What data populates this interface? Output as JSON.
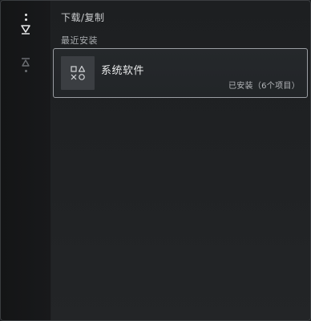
{
  "colors": {
    "background": "#1e2022",
    "rail": "#151617",
    "card_border": "#9a9ea3",
    "thumb": "#3b3e42"
  },
  "rail": {
    "items": [
      {
        "icon": "download-icon",
        "active": true
      },
      {
        "icon": "upload-icon",
        "active": false
      }
    ]
  },
  "header": {
    "breadcrumb": "下载/复制"
  },
  "section": {
    "label": "最近安装"
  },
  "items": [
    {
      "icon": "playstation-shapes-icon",
      "title": "系统软件",
      "status": "已安装（6个项目）"
    }
  ]
}
